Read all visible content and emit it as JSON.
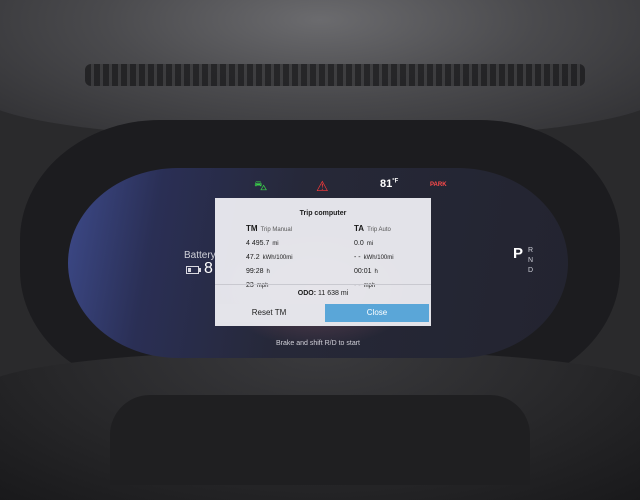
{
  "status": {
    "outside_temp": "81",
    "temp_unit": "°F",
    "park_label": "PARK"
  },
  "battery": {
    "label": "Battery",
    "value": "8"
  },
  "gear": {
    "current": "P",
    "options": [
      "R",
      "N",
      "D"
    ]
  },
  "dialog": {
    "title": "Trip computer",
    "trip_manual": {
      "code": "TM",
      "name": "Trip Manual",
      "distance": "4 495.7",
      "distance_unit": "mi",
      "consumption": "47.2",
      "consumption_unit": "kWh/100mi",
      "time": "99:28",
      "time_unit": "h",
      "speed": "23",
      "speed_unit": "mph"
    },
    "trip_auto": {
      "code": "TA",
      "name": "Trip Auto",
      "distance": "0.0",
      "distance_unit": "mi",
      "consumption": "- -",
      "consumption_unit": "kWh/100mi",
      "time": "00:01",
      "time_unit": "h",
      "speed": "- -",
      "speed_unit": "mph"
    },
    "odo_label": "ODO:",
    "odo_value": "11 638",
    "odo_unit": "mi",
    "reset_label": "Reset TM",
    "close_label": "Close"
  },
  "hint": "Brake and shift R/D to start",
  "colors": {
    "close_button": "#5aa6d8",
    "car_indicator": "#3ad04a",
    "warning": "#ff3a3a"
  }
}
